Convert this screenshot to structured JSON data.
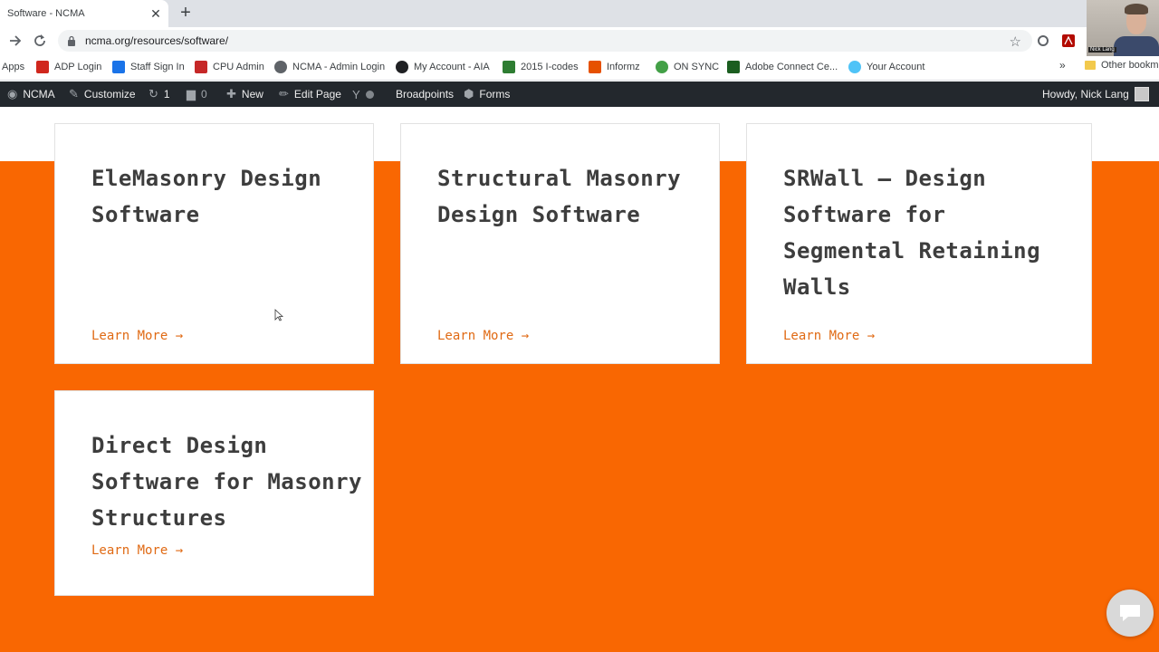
{
  "browser": {
    "tab_title": "Software - NCMA",
    "tab_close": "✕",
    "new_tab": "+",
    "url": "ncma.org/resources/software/",
    "bookmarks": [
      {
        "label": "Apps",
        "icon": "apps-grid-icon",
        "color": "#4285f4"
      },
      {
        "label": "ADP Login",
        "icon": "adp-icon",
        "color": "#d0271d"
      },
      {
        "label": "Staff Sign In",
        "icon": "info-icon",
        "color": "#1a73e8"
      },
      {
        "label": "CPU Admin",
        "icon": "bars-icon",
        "color": "#c62828"
      },
      {
        "label": "NCMA - Admin Login",
        "icon": "globe-icon",
        "color": "#5f6368"
      },
      {
        "label": "My Account - AIA",
        "icon": "aia-icon",
        "color": "#202124"
      },
      {
        "label": "2015 I-codes",
        "icon": "spreadsheet-icon",
        "color": "#2e7d32"
      },
      {
        "label": "Informz",
        "icon": "informz-icon",
        "color": "#e65100"
      },
      {
        "label": "ON SYNC",
        "icon": "sync-icon",
        "color": "#43a047"
      },
      {
        "label": "Adobe Connect Ce...",
        "icon": "adobe-connect-icon",
        "color": "#1b5e20"
      },
      {
        "label": "Your Account",
        "icon": "account-icon",
        "color": "#4fc3f7"
      }
    ],
    "more": "»",
    "other_bookmarks": "Other bookm"
  },
  "webcam": {
    "label": "Nick Lang"
  },
  "adminbar": {
    "site": "NCMA",
    "customize": "Customize",
    "updates": "1",
    "comments": "0",
    "new": "New",
    "edit_page": "Edit Page",
    "broadpoints": "Broadpoints",
    "forms": "Forms",
    "howdy": "Howdy, Nick Lang"
  },
  "cards": [
    {
      "title": "EleMasonry Design Software",
      "link": "Learn More →"
    },
    {
      "title": "Structural Masonry Design Software",
      "link": "Learn More →"
    },
    {
      "title": "SRWall – Design Software for Segmental Retaining Walls",
      "link": "Learn More →"
    },
    {
      "title": "Direct Design Software for Masonry Structures",
      "link": "Learn More →"
    }
  ],
  "colors": {
    "accent": "#f96702",
    "link": "#e06a14",
    "adminbar": "#23282d"
  }
}
